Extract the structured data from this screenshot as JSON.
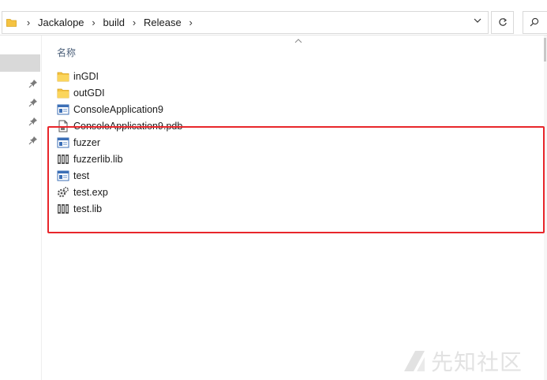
{
  "address_bar": {
    "crumbs": [
      "Jackalope",
      "build",
      "Release"
    ]
  },
  "file_list": {
    "column_header": "名称",
    "files": [
      {
        "name": "inGDI",
        "icon": "folder-icon"
      },
      {
        "name": "outGDI",
        "icon": "folder-icon"
      },
      {
        "name": "ConsoleApplication9",
        "icon": "application-icon"
      },
      {
        "name": "ConsoleApplication9.pdb",
        "icon": "pdb-file-icon"
      },
      {
        "name": "fuzzer",
        "icon": "application-icon"
      },
      {
        "name": "fuzzerlib.lib",
        "icon": "library-icon"
      },
      {
        "name": "test",
        "icon": "application-icon"
      },
      {
        "name": "test.exp",
        "icon": "exp-file-icon"
      },
      {
        "name": "test.lib",
        "icon": "library-icon"
      }
    ]
  },
  "watermark": {
    "text": "先知社区"
  },
  "colors": {
    "highlight": "#e8262b",
    "folder": "#f5c342",
    "header_text": "#4c607a"
  }
}
